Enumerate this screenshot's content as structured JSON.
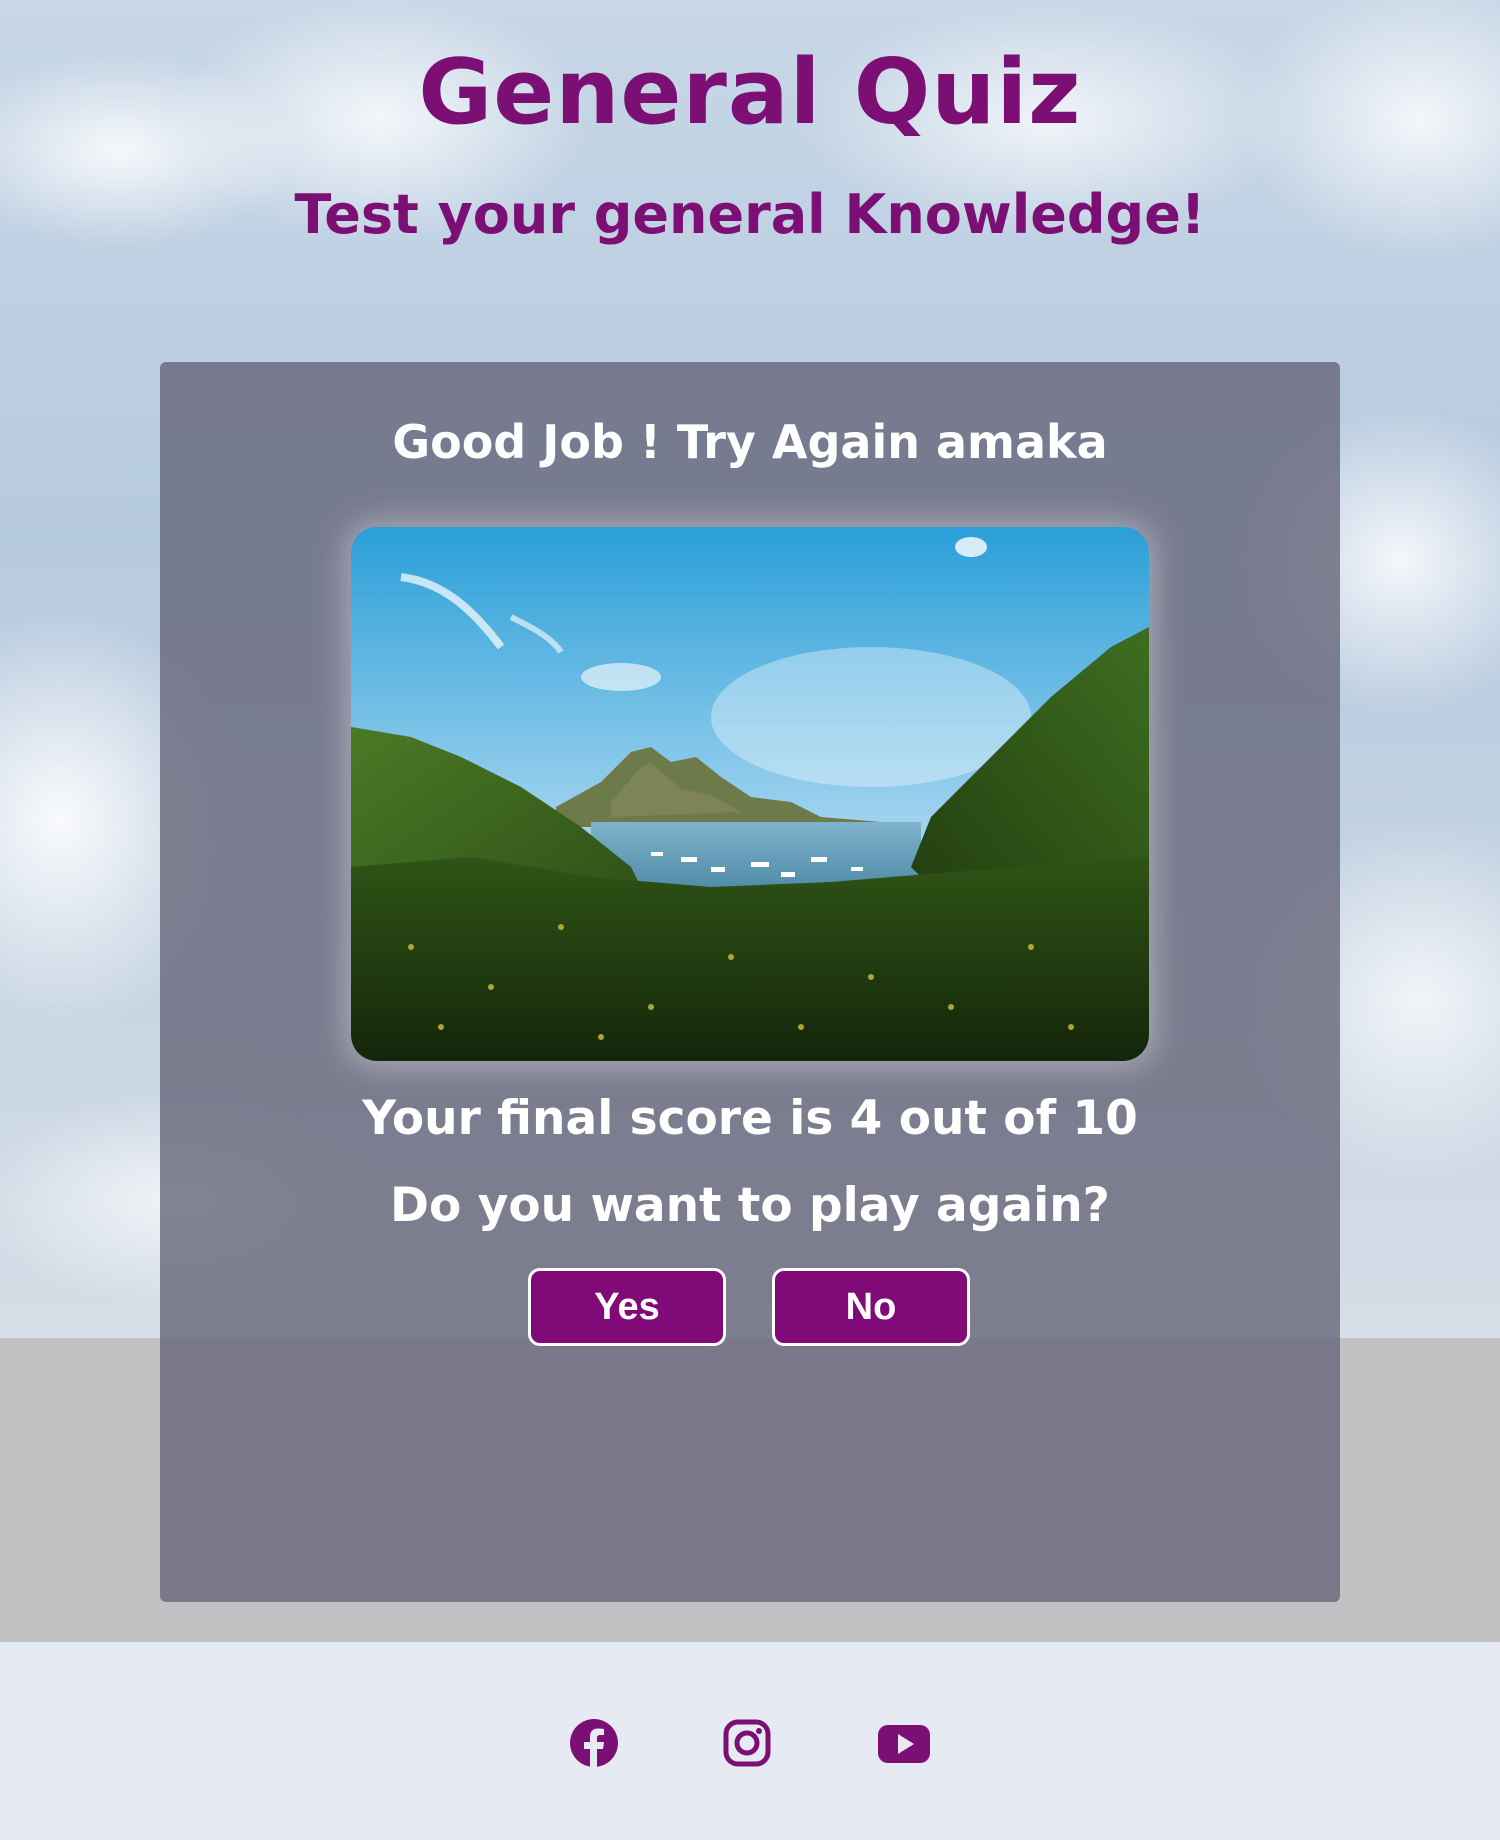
{
  "header": {
    "title": "General Quiz",
    "subtitle": "Test your general Knowledge!"
  },
  "result": {
    "heading": "Good Job ! Try Again amaka",
    "score_text": "Your final score is 4 out of 10",
    "play_again_prompt": "Do you want to play again?",
    "yes_label": "Yes",
    "no_label": "No",
    "image_alt": "Scenic bay with green hills, mountains and boats"
  },
  "footer": {
    "social_links": [
      {
        "name": "facebook",
        "icon": "facebook-icon",
        "aria_label": "Facebook"
      },
      {
        "name": "instagram",
        "icon": "instagram-icon",
        "aria_label": "Instagram"
      },
      {
        "name": "youtube",
        "icon": "youtube-icon",
        "aria_label": "YouTube"
      }
    ]
  },
  "colors": {
    "brand_purple": "#7b0f74",
    "button_purple": "#800b78",
    "card_overlay": "#69697d",
    "footer_bg": "#e6eaf2",
    "band_gray": "#c2c2c4"
  }
}
